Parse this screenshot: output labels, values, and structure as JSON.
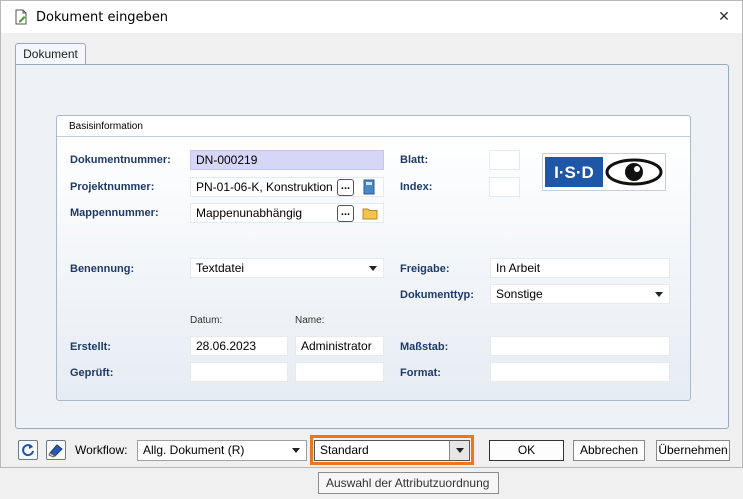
{
  "window": {
    "title": "Dokument eingeben",
    "close_glyph": "✕"
  },
  "tabs": [
    {
      "label": "Dokument"
    }
  ],
  "groupbox": {
    "title": "Basisinformation"
  },
  "labels": {
    "dokumentnummer": "Dokumentnummer:",
    "projektnummer": "Projektnummer:",
    "mappennummer": "Mappennummer:",
    "blatt": "Blatt:",
    "index": "Index:",
    "benennung": "Benennung:",
    "freigabe": "Freigabe:",
    "dokumenttyp": "Dokumenttyp:",
    "datum": "Datum:",
    "name": "Name:",
    "erstellt": "Erstellt:",
    "geprueft": "Geprüft:",
    "massstab": "Maßstab:",
    "format": "Format:"
  },
  "fields": {
    "dokumentnummer": "DN-000219",
    "projektnummer": "PN-01-06-K, Konstruktion",
    "mappennummer": "Mappenunabhängig",
    "blatt": "",
    "index": "",
    "benennung": "Textdatei",
    "freigabe": "In Arbeit",
    "dokumenttyp": "Sonstige",
    "erstellt_datum": "28.06.2023",
    "erstellt_name": "Administrator",
    "geprueft_datum": "",
    "geprueft_name": "",
    "massstab": "",
    "format": ""
  },
  "browse_label": "...",
  "logo": {
    "text": "I·S·D"
  },
  "footer": {
    "workflow_label": "Workflow:",
    "workflow_value": "Allg. Dokument (R)",
    "attribute_mapping_value": "Standard",
    "ok_label": "OK",
    "cancel_label": "Abbrechen",
    "apply_label": "Übernehmen"
  },
  "tooltip": "Auswahl der Attributzuordnung",
  "colors": {
    "label_blue": "#1f3a68",
    "highlight": "#e87722",
    "doc_number_bg": "#d6d6f7"
  }
}
